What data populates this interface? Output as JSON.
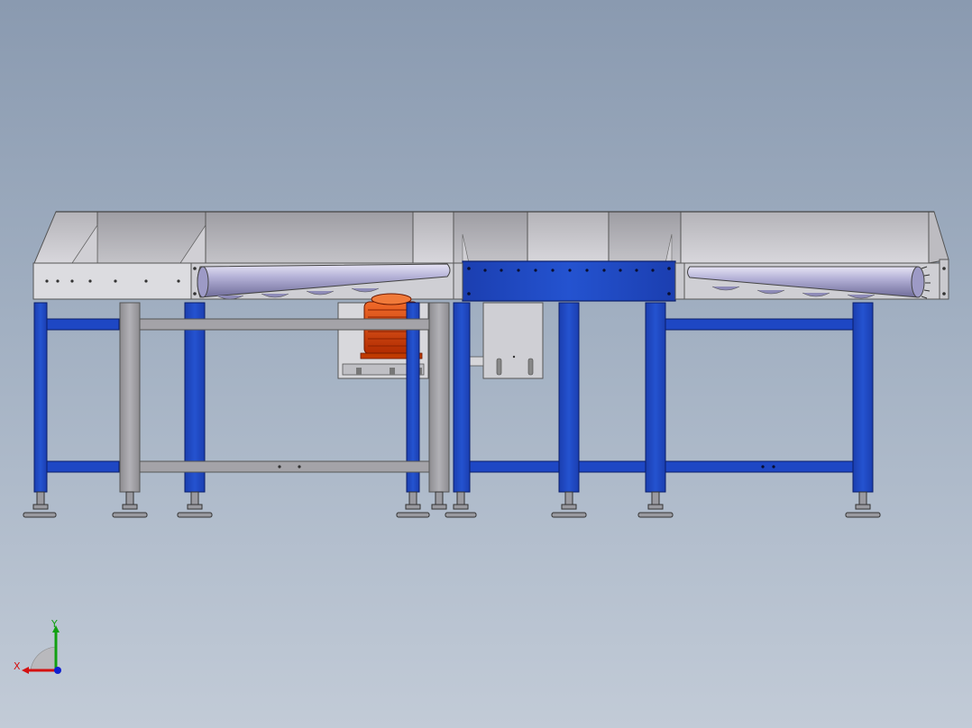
{
  "viewport": {
    "background_top": "#8a9ab0",
    "background_bottom": "#c2cbd7"
  },
  "model": {
    "frame_blue": "#1a3fb5",
    "frame_blue_dark": "#0d2a8a",
    "steel_gray": "#9a9a9e",
    "steel_light": "#c8c8cc",
    "motor_orange": "#e04a10",
    "roller_color": "#b7b4d4"
  },
  "triad": {
    "x_label": "X",
    "y_label": "Y",
    "x_color": "#d41010",
    "y_color": "#12a012",
    "z_color": "#1020d0"
  }
}
